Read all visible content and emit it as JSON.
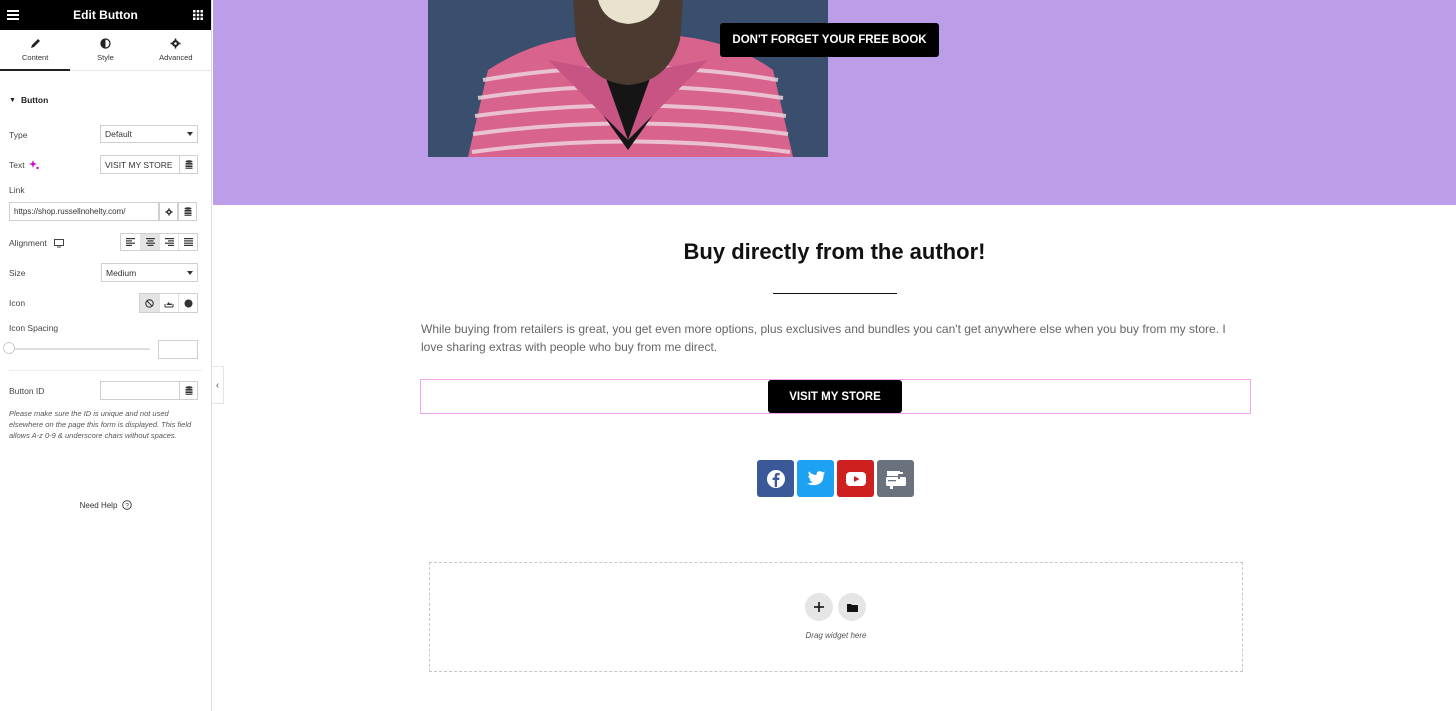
{
  "panel": {
    "title": "Edit Button",
    "tabs": [
      {
        "label": "Content",
        "icon": "pencil-icon",
        "active": true
      },
      {
        "label": "Style",
        "icon": "half-circle-icon"
      },
      {
        "label": "Advanced",
        "icon": "gear-icon"
      }
    ],
    "section": "Button",
    "fields": {
      "type_label": "Type",
      "type_value": "Default",
      "text_label": "Text",
      "text_value": "VISIT MY STORE",
      "link_label": "Link",
      "link_value": "https://shop.russellnohelty.com/",
      "alignment_label": "Alignment",
      "size_label": "Size",
      "size_value": "Medium",
      "icon_label": "Icon",
      "icon_spacing_label": "Icon Spacing",
      "button_id_label": "Button ID",
      "button_id_value": ""
    },
    "note": "Please make sure the ID is unique and not used elsewhere on the page this form is displayed. This field allows A-z 0-9 & underscore chars without spaces.",
    "help": "Need Help"
  },
  "canvas": {
    "hero_button": "DON'T FORGET YOUR FREE BOOK",
    "heading": "Buy directly from the author!",
    "paragraph": "While buying from retailers is great, you get even more options, plus exclusives and bundles you can't get anywhere else when you buy from my store. I love sharing extras with people who buy from me direct.",
    "store_button": "VISIT MY STORE",
    "drop_text": "Drag widget here",
    "socials": [
      {
        "name": "facebook",
        "color": "#3b5998"
      },
      {
        "name": "twitter",
        "color": "#1da1f2"
      },
      {
        "name": "youtube",
        "color": "#cd201f"
      },
      {
        "name": "mailbox",
        "color": "#69727d"
      }
    ]
  },
  "colors": {
    "hero_bg": "#bc9ee8",
    "accent": "#d004d4"
  }
}
